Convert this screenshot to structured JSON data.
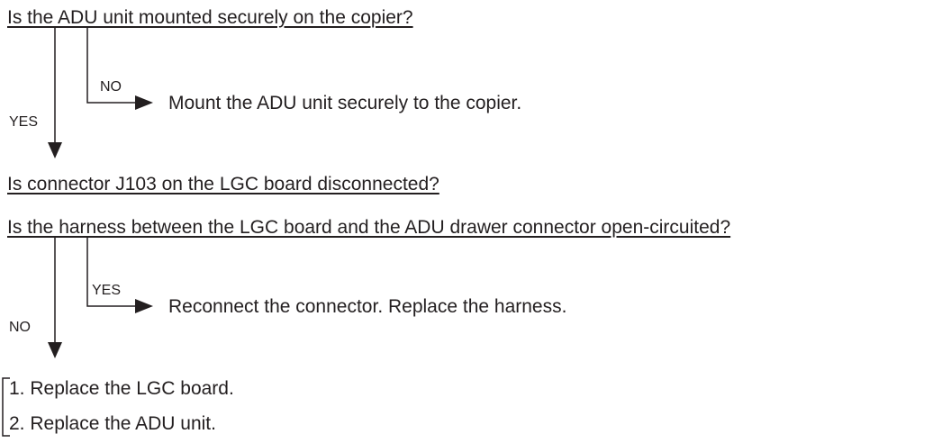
{
  "flow": {
    "question1": "Is the ADU unit mounted securely on the copier?",
    "branch1_side_label": "NO",
    "action1": "Mount the ADU unit securely to the copier.",
    "branch1_down_label": "YES",
    "question2": "Is connector J103 on the LGC board disconnected?",
    "question3": "Is the harness between the LGC board and the ADU drawer connector open-circuited?",
    "branch2_side_label": "YES",
    "action2": "Reconnect the connector. Replace the harness.",
    "branch2_down_label": "NO",
    "steps": [
      "1.  Replace the LGC board.",
      "2.  Replace the ADU unit."
    ]
  },
  "colors": {
    "ink": "#231f20",
    "background": "#ffffff"
  }
}
